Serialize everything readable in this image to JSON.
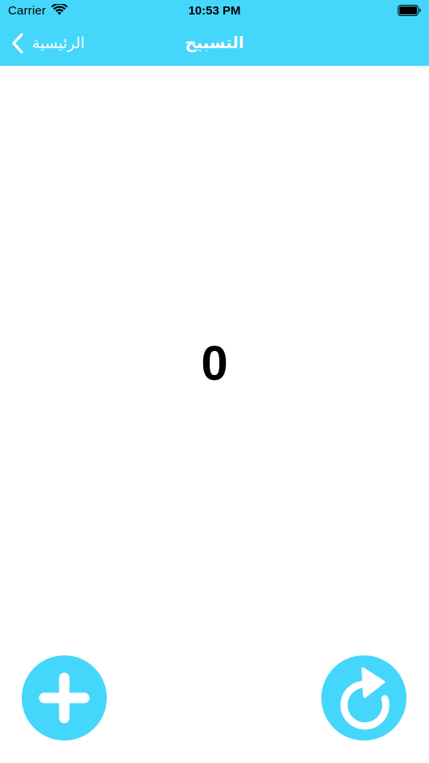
{
  "status_bar": {
    "carrier": "Carrier",
    "time": "10:53 PM",
    "wifi_icon": "wifi-icon",
    "battery_icon": "battery-icon"
  },
  "nav": {
    "back_label": "الرئيسية",
    "back_icon": "chevron-left-icon",
    "title": "التسبيح"
  },
  "counter": {
    "value": "0"
  },
  "buttons": {
    "add_icon": "plus-icon",
    "reset_icon": "reset-arrow-icon"
  },
  "colors": {
    "accent": "#45d6fb",
    "background": "#ffffff",
    "counter_text": "#000000"
  }
}
